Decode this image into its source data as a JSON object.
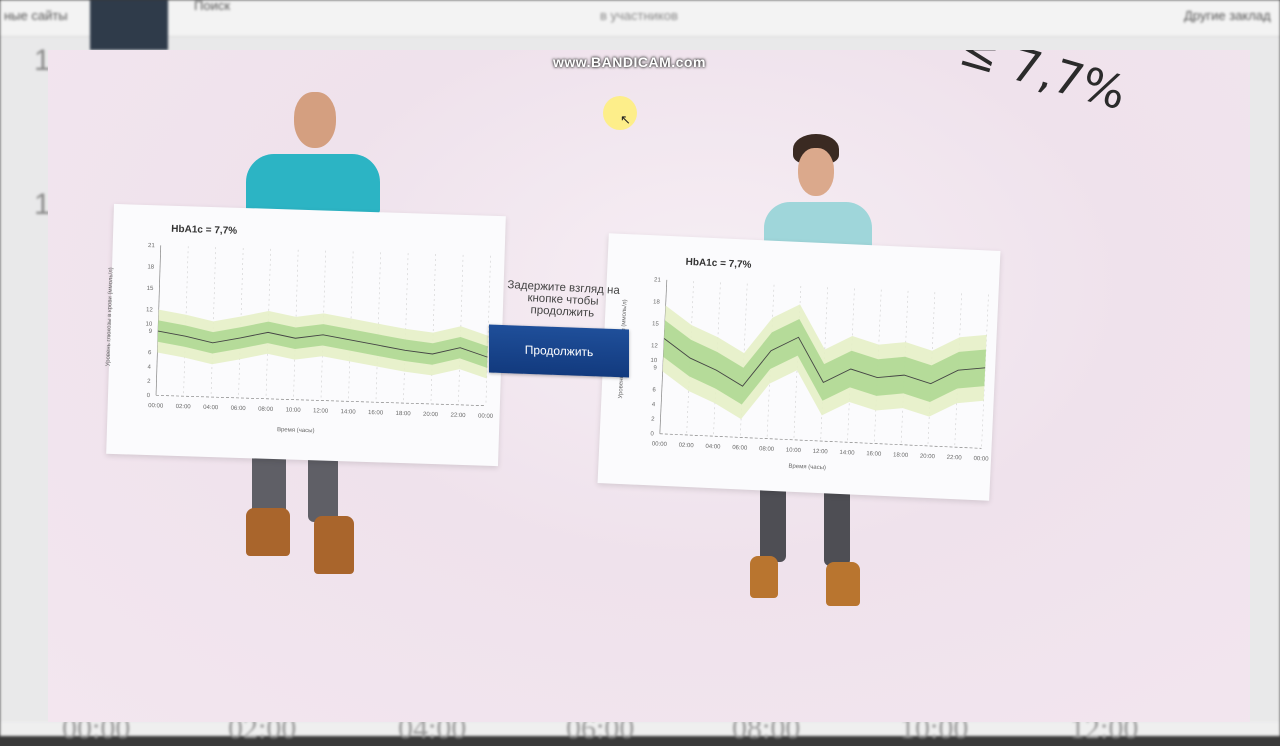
{
  "browser_bg": {
    "bookmarks_left": "ные сайты",
    "search_placeholder": "Поиск",
    "chat_line2": "в участников",
    "bookmarks_right": "Другие заклад",
    "time_labels": [
      "00:00",
      "02:00",
      "04:00",
      "06:00",
      "08:00",
      "10:00",
      "12:00"
    ],
    "side_nums": [
      "1",
      "1"
    ]
  },
  "video": {
    "watermark": "www.BANDICAM.com",
    "formula_fragment": "≤ 7,7%",
    "prompt": "Задержите взгляд на кнопке чтобы продолжить",
    "continue_button": "Продолжить",
    "colors": {
      "button": "#173f86",
      "band_inner": "#a8d68c",
      "band_outer": "#e6efc6",
      "line": "#444444"
    }
  },
  "chart_data": [
    {
      "type": "area",
      "title": "HbA1c = 7,7%",
      "xlabel": "Время (часы)",
      "ylabel": "Уровень глюкозы в крови (ммоль/л)",
      "ylim": [
        0,
        21
      ],
      "yticks": [
        0,
        2,
        4,
        6,
        9,
        10,
        12,
        15,
        18,
        21
      ],
      "x": [
        "00:00",
        "02:00",
        "04:00",
        "06:00",
        "08:00",
        "10:00",
        "12:00",
        "14:00",
        "16:00",
        "18:00",
        "20:00",
        "22:00",
        "00:00"
      ],
      "series": [
        {
          "name": "",
          "values": [
            9.0,
            8.4,
            7.6,
            8.4,
            9.3,
            8.6,
            9.2,
            8.6,
            8.0,
            7.4,
            7.0,
            8.0,
            6.8
          ]
        }
      ],
      "band_inner": 1.5,
      "band_outer": 3.0,
      "grid": true
    },
    {
      "type": "area",
      "title": "HbA1c = 7,7%",
      "xlabel": "Время (часы)",
      "ylabel": "Уровень глюкозы в крови (ммоль/л)",
      "ylim": [
        0,
        21
      ],
      "yticks": [
        0,
        2,
        4,
        6,
        9,
        10,
        12,
        15,
        18,
        21
      ],
      "x": [
        "00:00",
        "02:00",
        "04:00",
        "06:00",
        "08:00",
        "10:00",
        "12:00",
        "14:00",
        "16:00",
        "18:00",
        "20:00",
        "22:00",
        "00:00"
      ],
      "series": [
        {
          "name": "",
          "values": [
            13.0,
            10.5,
            9.0,
            7.0,
            12.0,
            14.0,
            8.0,
            10.0,
            9.0,
            9.5,
            8.5,
            10.5,
            11.0
          ]
        }
      ],
      "band_inner": 2.5,
      "band_outer": 4.5,
      "grid": true
    }
  ]
}
